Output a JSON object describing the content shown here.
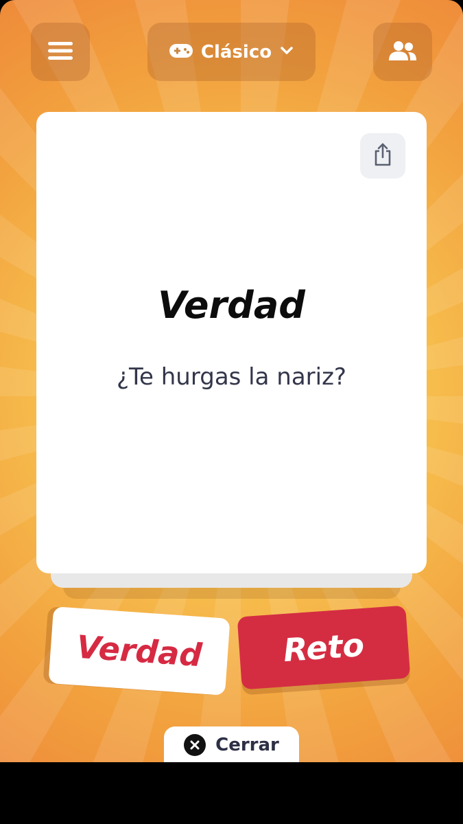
{
  "header": {
    "mode_label": "Clásico",
    "icons": {
      "menu": "hamburger-menu-icon",
      "mode": "gamepad-icon",
      "dropdown": "chevron-down-icon",
      "players": "users-icon"
    }
  },
  "card": {
    "title": "Verdad",
    "question": "¿Te hurgas la nariz?",
    "share_icon": "share-icon"
  },
  "actions": {
    "truth_label": "Verdad",
    "dare_label": "Reto",
    "close_label": "Cerrar",
    "close_icon": "close-circle-icon"
  },
  "colors": {
    "background_inner": "#fbd868",
    "background_outer": "#ee8a3a",
    "accent_red": "#d42d42",
    "card": "#ffffff",
    "question_text": "#33364a"
  }
}
